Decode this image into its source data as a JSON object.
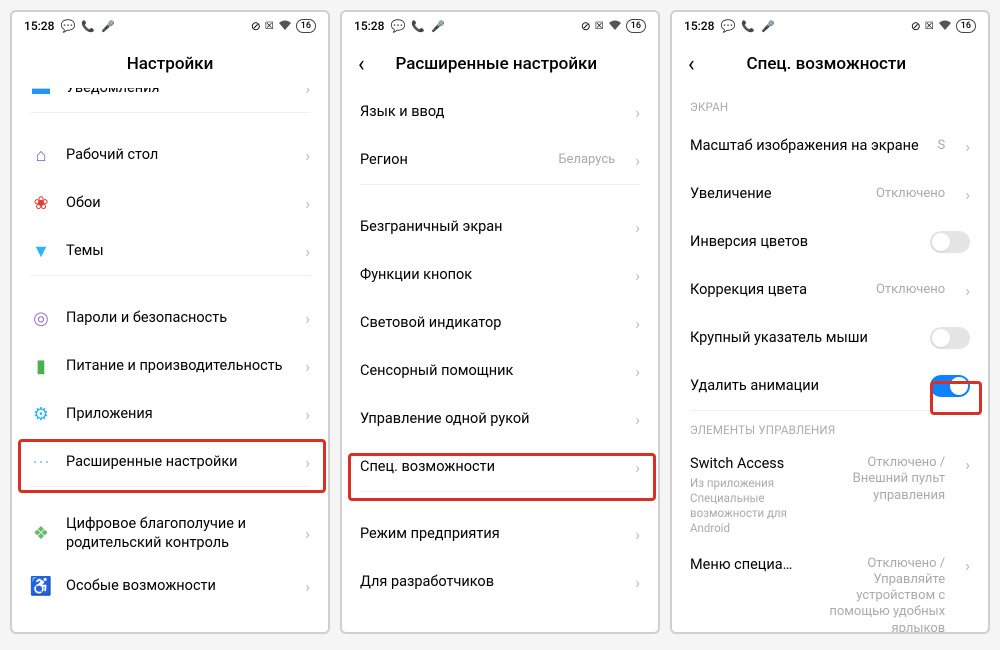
{
  "status": {
    "time": "15:28",
    "battery": "16"
  },
  "p1": {
    "title": "Настройки",
    "rows": {
      "r0": "Уведомления",
      "r1": "Рабочий стол",
      "r2": "Обои",
      "r3": "Темы",
      "r4": "Пароли и безопасность",
      "r5": "Питание и производительность",
      "r6": "Приложения",
      "r7": "Расширенные настройки",
      "r8": "Цифровое благополучие и родительский контроль",
      "r9": "Особые возможности"
    }
  },
  "p2": {
    "title": "Расширенные настройки",
    "rows": {
      "r0": "Язык и ввод",
      "r1": "Регион",
      "r1v": "Беларусь",
      "r2": "Безграничный экран",
      "r3": "Функции кнопок",
      "r4": "Световой индикатор",
      "r5": "Сенсорный помощник",
      "r6": "Управление одной рукой",
      "r7": "Спец. возможности",
      "r8": "Режим предприятия",
      "r9": "Для разработчиков"
    }
  },
  "p3": {
    "title": "Спец. возможности",
    "sec1": "ЭКРАН",
    "sec2": "ЭЛЕМЕНТЫ УПРАВЛЕНИЯ",
    "rows": {
      "r0": "Масштаб изображения на экране",
      "r0v": "S",
      "r1": "Увеличение",
      "r1v": "Отключено",
      "r2": "Инверсия цветов",
      "r3": "Коррекция цвета",
      "r3v": "Отключено",
      "r4": "Крупный указатель мыши",
      "r5": "Удалить анимации",
      "r6": "Switch Access",
      "r6s": "Из приложения Специальные возможности для Android",
      "r6v": "Отключено / Внешний пульт управления",
      "r7": "Меню специальных во…",
      "r7v": "Отключено / Управляйте устройством с помощью удобных ярлыков"
    }
  }
}
